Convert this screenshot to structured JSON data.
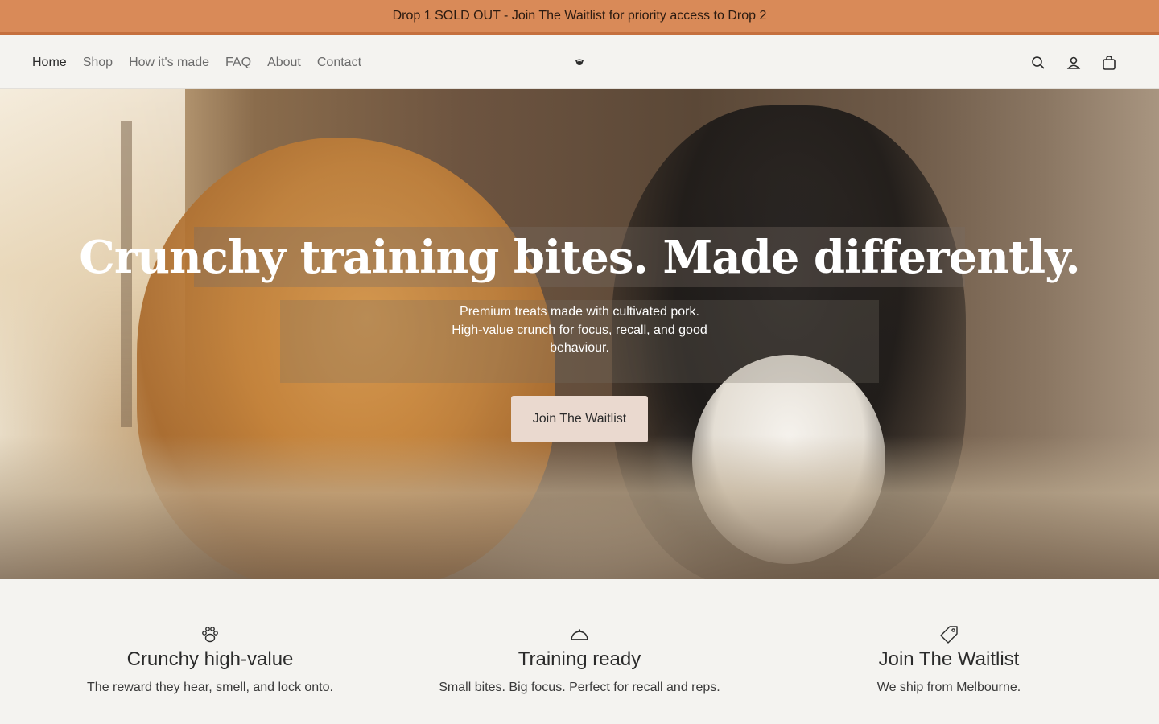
{
  "announcement": {
    "text": "Drop 1 SOLD OUT - Join The Waitlist for priority access to Drop 2"
  },
  "nav": {
    "items": [
      {
        "label": "Home"
      },
      {
        "label": "Shop"
      },
      {
        "label": "How it's made"
      },
      {
        "label": "FAQ"
      },
      {
        "label": "About"
      },
      {
        "label": "Contact"
      }
    ],
    "active": "Home"
  },
  "header_icons": [
    "search-icon",
    "account-icon",
    "cart-icon"
  ],
  "hero": {
    "title": "Crunchy training bites. Made differently.",
    "subtitle": "Premium treats made with cultivated pork. High-value crunch for focus, recall, and good behaviour.",
    "cta_label": "Join The Waitlist"
  },
  "features": [
    {
      "icon": "paw-icon",
      "title": "Crunchy high-value",
      "text": "The reward they hear, smell, and lock onto."
    },
    {
      "icon": "bowl-icon",
      "title": "Training ready",
      "text": "Small bites. Big focus. Perfect for recall and reps."
    },
    {
      "icon": "tag-icon",
      "title": "Join The Waitlist",
      "text": "We ship from Melbourne."
    }
  ],
  "colors": {
    "announcement_bg": "#d98a58",
    "page_bg": "#f4f3f0",
    "cta_bg": "#ead9cf"
  }
}
